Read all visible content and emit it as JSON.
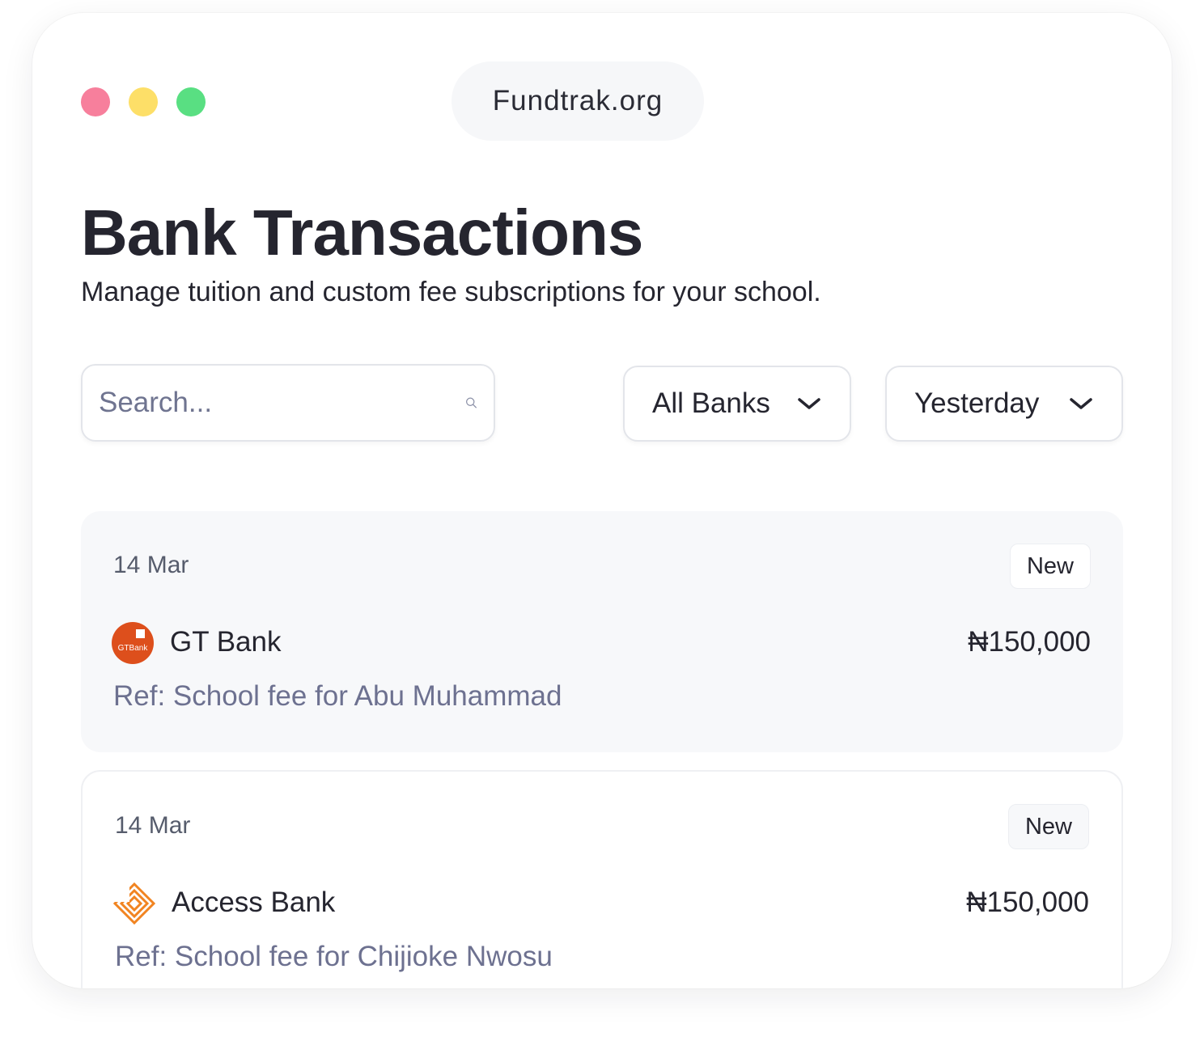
{
  "window": {
    "dots": [
      {
        "name": "close-dot",
        "color": "#f77f9c"
      },
      {
        "name": "minimize-dot",
        "color": "#fddf68"
      },
      {
        "name": "maximize-dot",
        "color": "#59df82"
      }
    ],
    "url": "Fundtrak.org"
  },
  "page": {
    "title": "Bank Transactions",
    "subtitle": "Manage tuition and custom fee subscriptions for your school."
  },
  "filters": {
    "search_placeholder": "Search...",
    "bank_select": "All Banks",
    "date_select": "Yesterday"
  },
  "transactions": [
    {
      "date": "14 Mar",
      "badge": "New",
      "bank": "GT Bank",
      "bank_icon": "gtbank-logo",
      "logo_text": "GTBank",
      "amount": "₦150,000",
      "ref": "Ref: School fee for Abu Muhammad"
    },
    {
      "date": "14 Mar",
      "badge": "New",
      "bank": "Access Bank",
      "bank_icon": "access-bank-logo",
      "amount": "₦150,000",
      "ref": "Ref: School fee for Chijioke Nwosu"
    }
  ],
  "colors": {
    "gtbank": "#dd4f1c",
    "access": "#f18421",
    "text": "#25252f",
    "muted": "#6d7190"
  }
}
